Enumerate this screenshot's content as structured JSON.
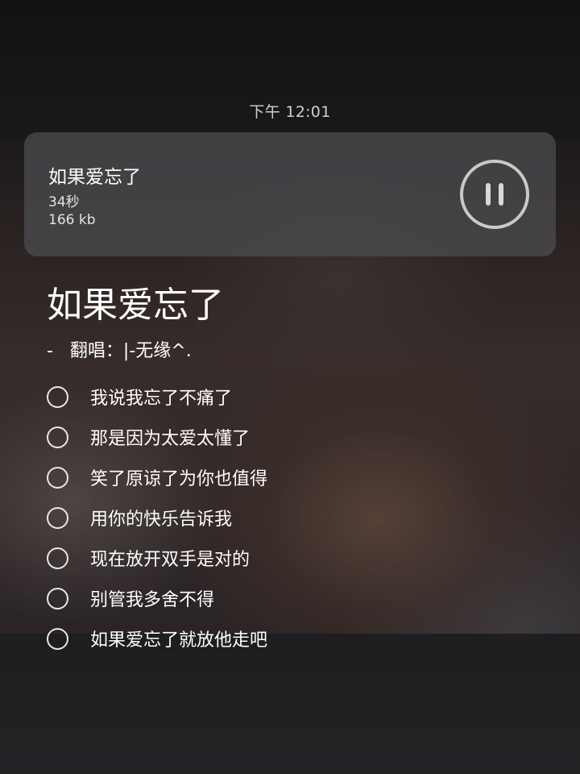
{
  "status_bar": {
    "time": "下午 12:01"
  },
  "player_card": {
    "title": "如果爱忘了",
    "duration": "34秒",
    "size": "166 kb",
    "button_icon": "pause-icon"
  },
  "song": {
    "title": "如果爱忘了",
    "artist_line": "-   翻唱：|-无缘^."
  },
  "lyrics": [
    "我说我忘了不痛了",
    "那是因为太爱太懂了",
    "笑了原谅了为你也值得",
    "用你的快乐告诉我",
    "现在放开双手是对的",
    "别管我多舍不得",
    "如果爱忘了就放他走吧"
  ]
}
